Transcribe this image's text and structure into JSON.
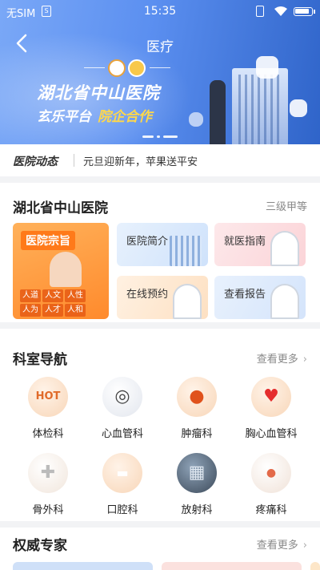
{
  "status_bar": {
    "carrier": "无SIM",
    "sim_badge": "S",
    "time": "15:35"
  },
  "header": {
    "title": "医疗"
  },
  "banner": {
    "title": "湖北省中山医院",
    "subtitle_left": "玄乐平台",
    "subtitle_right": "院企合作"
  },
  "news": {
    "logo": "医院动态",
    "text": "元旦迎新年，苹果送平安"
  },
  "hospital": {
    "name": "湖北省中山医院",
    "grade": "三级甲等",
    "feature_tile": {
      "label": "医院宗旨",
      "tags": [
        "人道",
        "人文",
        "人性",
        "人为",
        "人才",
        "人和"
      ]
    },
    "tiles": [
      {
        "label": "医院简介"
      },
      {
        "label": "就医指南"
      },
      {
        "label": "在线预约"
      },
      {
        "label": "查看报告"
      }
    ]
  },
  "departments": {
    "title": "科室导航",
    "more_label": "查看更多",
    "items": [
      {
        "name": "体检科",
        "icon": "checkup-icon"
      },
      {
        "name": "心血管科",
        "icon": "stethoscope-icon"
      },
      {
        "name": "肿瘤科",
        "icon": "tumor-icon"
      },
      {
        "name": "胸心血管科",
        "icon": "heart-icon"
      },
      {
        "name": "骨外科",
        "icon": "bandage-icon"
      },
      {
        "name": "口腔科",
        "icon": "tooth-icon"
      },
      {
        "name": "放射科",
        "icon": "xray-icon"
      },
      {
        "name": "疼痛科",
        "icon": "pain-icon"
      }
    ]
  },
  "experts": {
    "title": "权威专家",
    "more_label": "查看更多"
  },
  "colors": {
    "banner_blue": "#5b8ff0",
    "accent_orange": "#ff8a2c",
    "subtitle_yellow": "#ffd84a"
  }
}
